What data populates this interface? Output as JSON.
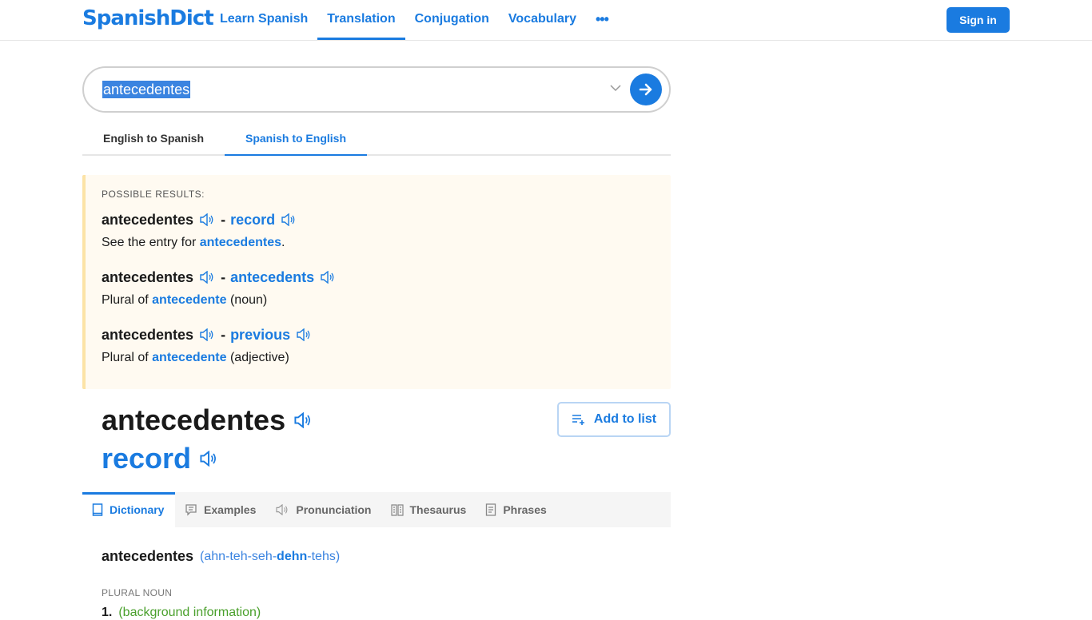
{
  "header": {
    "logo": "SpanishDict",
    "nav": [
      {
        "label": "Learn Spanish",
        "active": false
      },
      {
        "label": "Translation",
        "active": true
      },
      {
        "label": "Conjugation",
        "active": false
      },
      {
        "label": "Vocabulary",
        "active": false
      }
    ],
    "more_label": "•••",
    "sign_in": "Sign in"
  },
  "search": {
    "value": "antecedentes",
    "submit_icon": "arrow-right-icon",
    "dropdown_icon": "chevron-down-icon"
  },
  "direction_tabs": [
    {
      "label": "English to Spanish",
      "active": false
    },
    {
      "label": "Spanish to English",
      "active": true
    }
  ],
  "possible_results": {
    "title": "POSSIBLE RESULTS:",
    "items": [
      {
        "word": "antecedentes",
        "translation": "record",
        "desc_prefix": "See the entry for ",
        "desc_link": "antecedentes",
        "desc_suffix": "."
      },
      {
        "word": "antecedentes",
        "translation": "antecedents",
        "desc_prefix": "Plural of ",
        "desc_link": "antecedente",
        "desc_suffix": " (noun)"
      },
      {
        "word": "antecedentes",
        "translation": "previous",
        "desc_prefix": "Plural of ",
        "desc_link": "antecedente",
        "desc_suffix": " (adjective)"
      }
    ]
  },
  "headword": {
    "word": "antecedentes",
    "translation": "record",
    "add_to_list": "Add to list"
  },
  "content_tabs": [
    {
      "label": "Dictionary",
      "icon": "book-icon",
      "active": true
    },
    {
      "label": "Examples",
      "icon": "speech-bubble-icon",
      "active": false
    },
    {
      "label": "Pronunciation",
      "icon": "speaker-icon",
      "active": false
    },
    {
      "label": "Thesaurus",
      "icon": "open-book-icon",
      "active": false
    },
    {
      "label": "Phrases",
      "icon": "document-icon",
      "active": false
    }
  ],
  "entry": {
    "word": "antecedentes",
    "pron_open": "(ahn-teh-seh-",
    "pron_stress": "dehn",
    "pron_close": "-tehs)",
    "pos": "PLURAL NOUN",
    "sense_num": "1.",
    "sense_context": "(background information)"
  },
  "colors": {
    "brand": "#1a7be0",
    "results_bg": "#fffaf1",
    "results_border": "#fce3a6",
    "context_green": "#4aa02c"
  }
}
